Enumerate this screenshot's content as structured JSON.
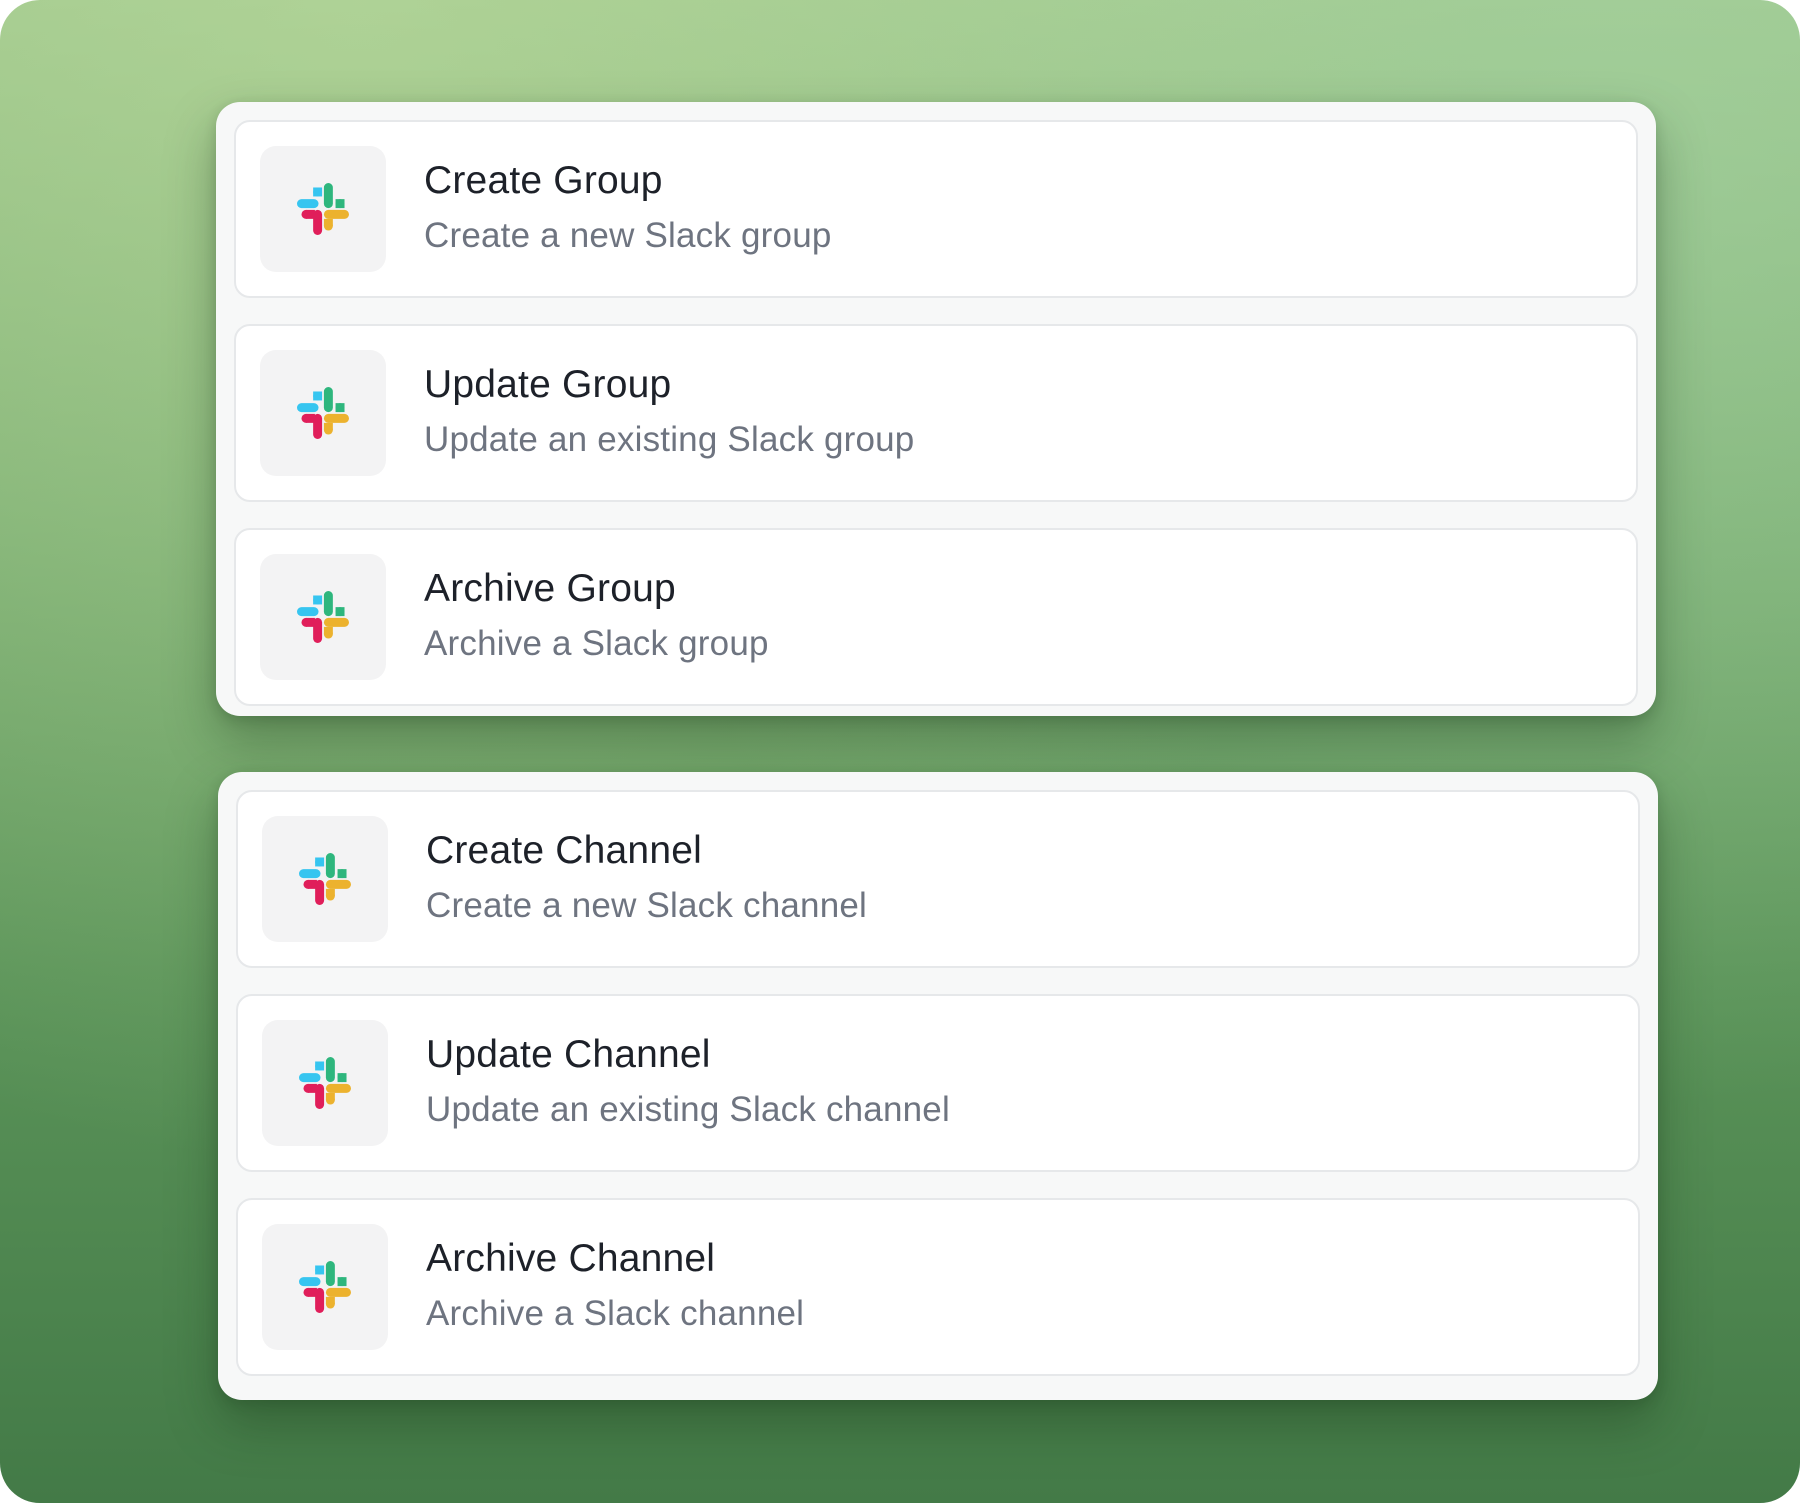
{
  "groups": {
    "items": [
      {
        "title": "Create Group",
        "description": "Create a new Slack group",
        "icon": "slack-icon"
      },
      {
        "title": "Update Group",
        "description": "Update an existing Slack group",
        "icon": "slack-icon"
      },
      {
        "title": "Archive Group",
        "description": "Archive a Slack group",
        "icon": "slack-icon"
      }
    ]
  },
  "channels": {
    "items": [
      {
        "title": "Create Channel",
        "description": "Create a new Slack channel",
        "icon": "slack-icon"
      },
      {
        "title": "Update Channel",
        "description": "Update an existing Slack channel",
        "icon": "slack-icon"
      },
      {
        "title": "Archive Channel",
        "description": "Archive a Slack channel",
        "icon": "slack-icon"
      }
    ]
  },
  "colors": {
    "slack_blue": "#36C5F0",
    "slack_green": "#2EB67D",
    "slack_yellow": "#ECB22E",
    "slack_red": "#E01E5A"
  }
}
